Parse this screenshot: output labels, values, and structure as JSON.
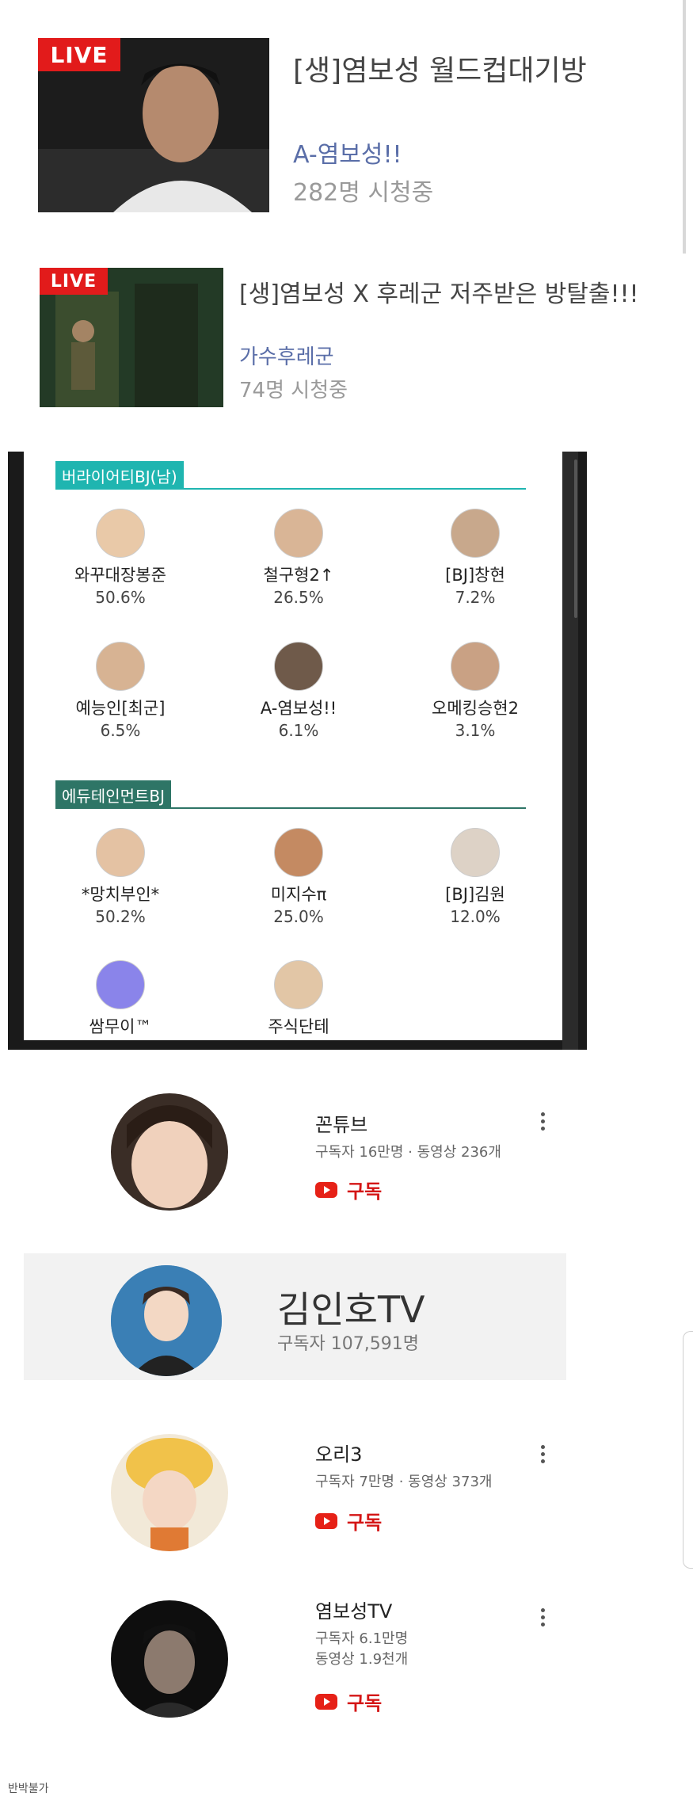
{
  "live": {
    "badge": "LIVE",
    "items": [
      {
        "title": "[생]염보성 월드컵대기방",
        "bj": "A-염보성!!",
        "viewers": "282명 시청중"
      },
      {
        "title": "[생]염보성 X 후레군 저주받은 방탈출!!!",
        "bj": "가수후레군",
        "viewers": "74명 시청중"
      }
    ]
  },
  "rank": {
    "categories": [
      {
        "name": "버라이어티BJ(남)",
        "color": "#1fb5b0",
        "entries": [
          {
            "name": "와꾸대장봉준",
            "pct": "50.6%"
          },
          {
            "name": "철구형2↑",
            "pct": "26.5%"
          },
          {
            "name": "[BJ]창현",
            "pct": "7.2%"
          },
          {
            "name": "예능인[최군]",
            "pct": "6.5%"
          },
          {
            "name": "A-염보성!!",
            "pct": "6.1%"
          },
          {
            "name": "오메킹승현2",
            "pct": "3.1%"
          }
        ]
      },
      {
        "name": "에듀테인먼트BJ",
        "color": "#2e7566",
        "entries": [
          {
            "name": "*망치부인*",
            "pct": "50.2%"
          },
          {
            "name": "미지수π",
            "pct": "25.0%"
          },
          {
            "name": "[BJ]김원",
            "pct": "12.0%"
          },
          {
            "name": "쌈무이™",
            "pct": ""
          },
          {
            "name": "주식단테",
            "pct": ""
          }
        ]
      }
    ]
  },
  "youtube": {
    "subscribe_label": "구독",
    "channels": [
      {
        "name": "꼰튜브",
        "meta1": "구독자 16만명 · 동영상 236개",
        "meta2": ""
      },
      {
        "name": "오리3",
        "meta1": "구독자 7만명 · 동영상 373개",
        "meta2": ""
      },
      {
        "name": "염보성TV",
        "meta1": "구독자 6.1만명",
        "meta2": "동영상 1.9천개"
      }
    ],
    "featured": {
      "name": "김인호TV",
      "subs": "구독자 107,591명"
    }
  },
  "footer": {
    "text": "반박불가"
  }
}
